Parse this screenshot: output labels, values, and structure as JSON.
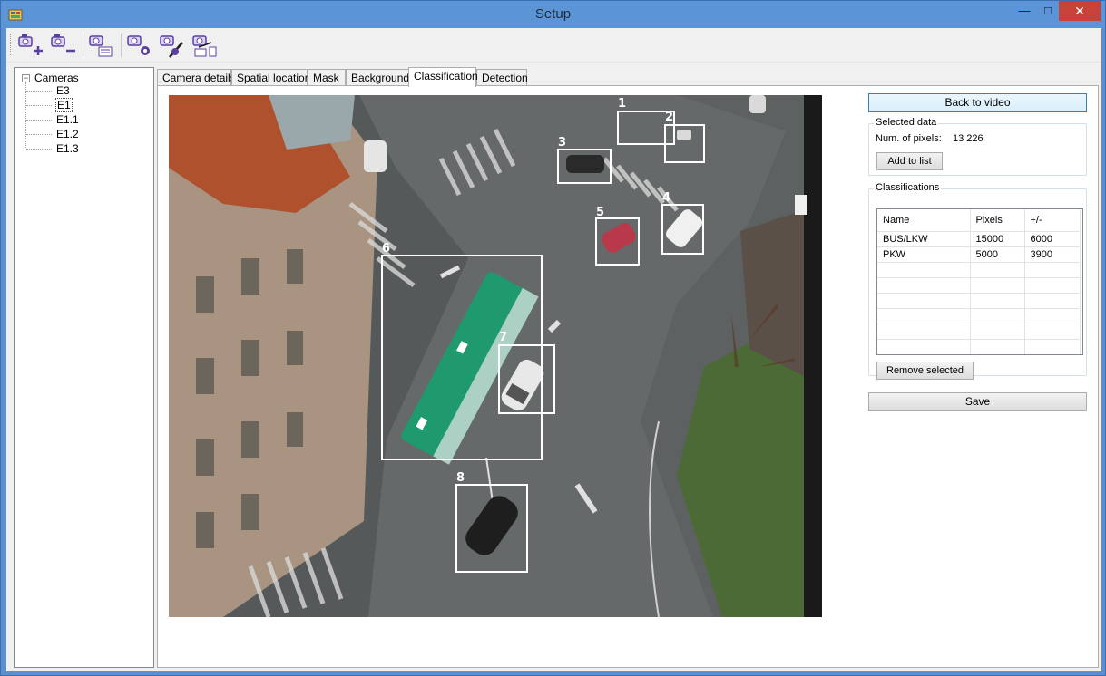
{
  "window": {
    "title": "Setup"
  },
  "toolbar": {
    "buttons": [
      {
        "name": "add-camera-icon"
      },
      {
        "name": "remove-camera-icon"
      },
      {
        "name": "camera-list-icon"
      },
      {
        "name": "camera-settings-icon"
      },
      {
        "name": "camera-paint-icon"
      },
      {
        "name": "camera-export-icon"
      }
    ]
  },
  "tree": {
    "root": "Cameras",
    "items": [
      "E3",
      "E1",
      "E1.1",
      "E1.2",
      "E1.3"
    ],
    "selected": "E1"
  },
  "tabs": [
    {
      "label": "Camera details"
    },
    {
      "label": "Spatial location"
    },
    {
      "label": "Mask"
    },
    {
      "label": "Background"
    },
    {
      "label": "Classification",
      "active": true
    },
    {
      "label": "Detection"
    }
  ],
  "video": {
    "detections": [
      "1",
      "2",
      "3",
      "4",
      "5",
      "6",
      "7",
      "8"
    ]
  },
  "side": {
    "back_button": "Back to video",
    "selected_data": {
      "title": "Selected data",
      "num_pixels_label": "Num. of pixels:",
      "num_pixels_value": "13 226",
      "add_button": "Add to list"
    },
    "classifications": {
      "title": "Classifications",
      "columns": [
        "Name",
        "Pixels",
        "+/-"
      ],
      "rows": [
        {
          "name": "BUS/LKW",
          "pixels": "15000",
          "tolerance": "6000"
        },
        {
          "name": "PKW",
          "pixels": "5000",
          "tolerance": "3900"
        }
      ],
      "remove_button": "Remove selected"
    },
    "save_button": "Save"
  },
  "colors": {
    "titlebar": "#5c95d6",
    "close": "#c7433a",
    "bus": "#1e9a6e",
    "road": "#6b6f70"
  }
}
